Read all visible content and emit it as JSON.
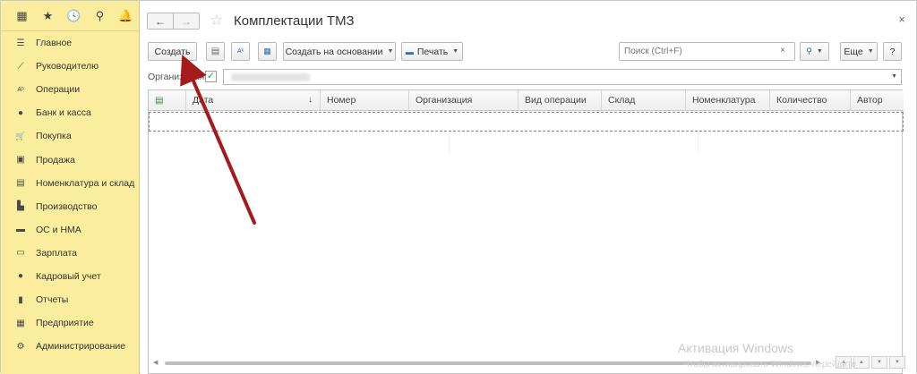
{
  "sidebar": {
    "top_icons": [
      {
        "name": "apps-grid-icon",
        "glyph": "▦"
      },
      {
        "name": "favorites-star-icon",
        "glyph": "★"
      },
      {
        "name": "history-icon",
        "glyph": "🕓"
      },
      {
        "name": "search-icon",
        "glyph": "⚲"
      },
      {
        "name": "notifications-bell-icon",
        "glyph": "🔔"
      }
    ],
    "items": [
      {
        "label": "Главное",
        "icon": "menu-lines-icon",
        "glyph": "☰"
      },
      {
        "label": "Руководителю",
        "icon": "trend-chart-icon",
        "glyph": "⟋"
      },
      {
        "label": "Операции",
        "icon": "operations-icon",
        "glyph": "Aᵇ"
      },
      {
        "label": "Банк и касса",
        "icon": "coin-icon",
        "glyph": "●"
      },
      {
        "label": "Покупка",
        "icon": "cart-icon",
        "glyph": "🛒"
      },
      {
        "label": "Продажа",
        "icon": "bag-icon",
        "glyph": "▣"
      },
      {
        "label": "Номенклатура и склад",
        "icon": "warehouse-icon",
        "glyph": "▤"
      },
      {
        "label": "Производство",
        "icon": "factory-icon",
        "glyph": "▙"
      },
      {
        "label": "ОС и НМА",
        "icon": "truck-icon",
        "glyph": "▬"
      },
      {
        "label": "Зарплата",
        "icon": "payroll-icon",
        "glyph": "▭"
      },
      {
        "label": "Кадровый учет",
        "icon": "person-icon",
        "glyph": "●"
      },
      {
        "label": "Отчеты",
        "icon": "reports-chart-icon",
        "glyph": "▮"
      },
      {
        "label": "Предприятие",
        "icon": "building-icon",
        "glyph": "▦"
      },
      {
        "label": "Администрирование",
        "icon": "gear-icon",
        "glyph": "⚙"
      }
    ]
  },
  "header": {
    "title": "Комплектации ТМЗ",
    "back_glyph": "←",
    "forward_glyph": "→",
    "star_glyph": "☆",
    "close_glyph": "×"
  },
  "toolbar": {
    "create_label": "Создать",
    "create_based_label": "Создать на основании",
    "print_label": "Печать",
    "more_label": "Еще",
    "help_label": "?",
    "search_placeholder": "Поиск (Ctrl+F)",
    "search_clear_glyph": "×",
    "search_glyph": "🔍"
  },
  "filter": {
    "org_label": "Организация:",
    "org_checked": true,
    "check_glyph": "✓"
  },
  "table": {
    "columns": [
      "Дата",
      "Номер",
      "Организация",
      "Вид операции",
      "Склад",
      "Номенклатура",
      "Количество",
      "Автор"
    ],
    "sort_glyph": "↓"
  },
  "watermark": {
    "line1": "Активация Windows",
    "line2": "Чтобы активировать Windows, перейдите"
  },
  "colors": {
    "sidebar_bg": "#fbed9e",
    "arrow": "#a31b1b",
    "check": "#2e9b3d"
  }
}
